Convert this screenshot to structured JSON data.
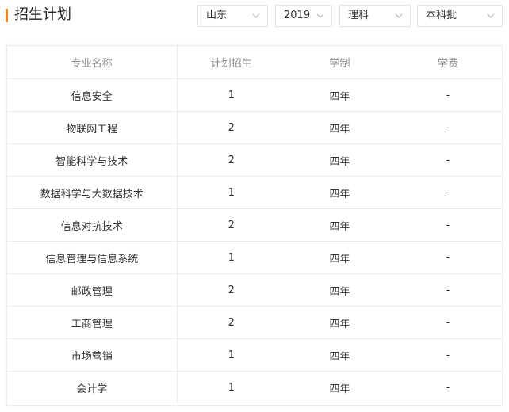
{
  "header": {
    "title": "招生计划",
    "accent_color": "#f5821f"
  },
  "filters": {
    "province": "山东",
    "year": "2019",
    "category": "理科",
    "batch": "本科批"
  },
  "table": {
    "columns": [
      "专业名称",
      "计划招生",
      "学制",
      "学费"
    ],
    "rows": [
      [
        "信息安全",
        "1",
        "四年",
        "-"
      ],
      [
        "物联网工程",
        "2",
        "四年",
        "-"
      ],
      [
        "智能科学与技术",
        "2",
        "四年",
        "-"
      ],
      [
        "数据科学与大数据技术",
        "1",
        "四年",
        "-"
      ],
      [
        "信息对抗技术",
        "2",
        "四年",
        "-"
      ],
      [
        "信息管理与信息系统",
        "1",
        "四年",
        "-"
      ],
      [
        "邮政管理",
        "2",
        "四年",
        "-"
      ],
      [
        "工商管理",
        "2",
        "四年",
        "-"
      ],
      [
        "市场营销",
        "1",
        "四年",
        "-"
      ],
      [
        "会计学",
        "1",
        "四年",
        "-"
      ]
    ]
  },
  "icons": {
    "dropdown": "chevron-down-icon"
  }
}
